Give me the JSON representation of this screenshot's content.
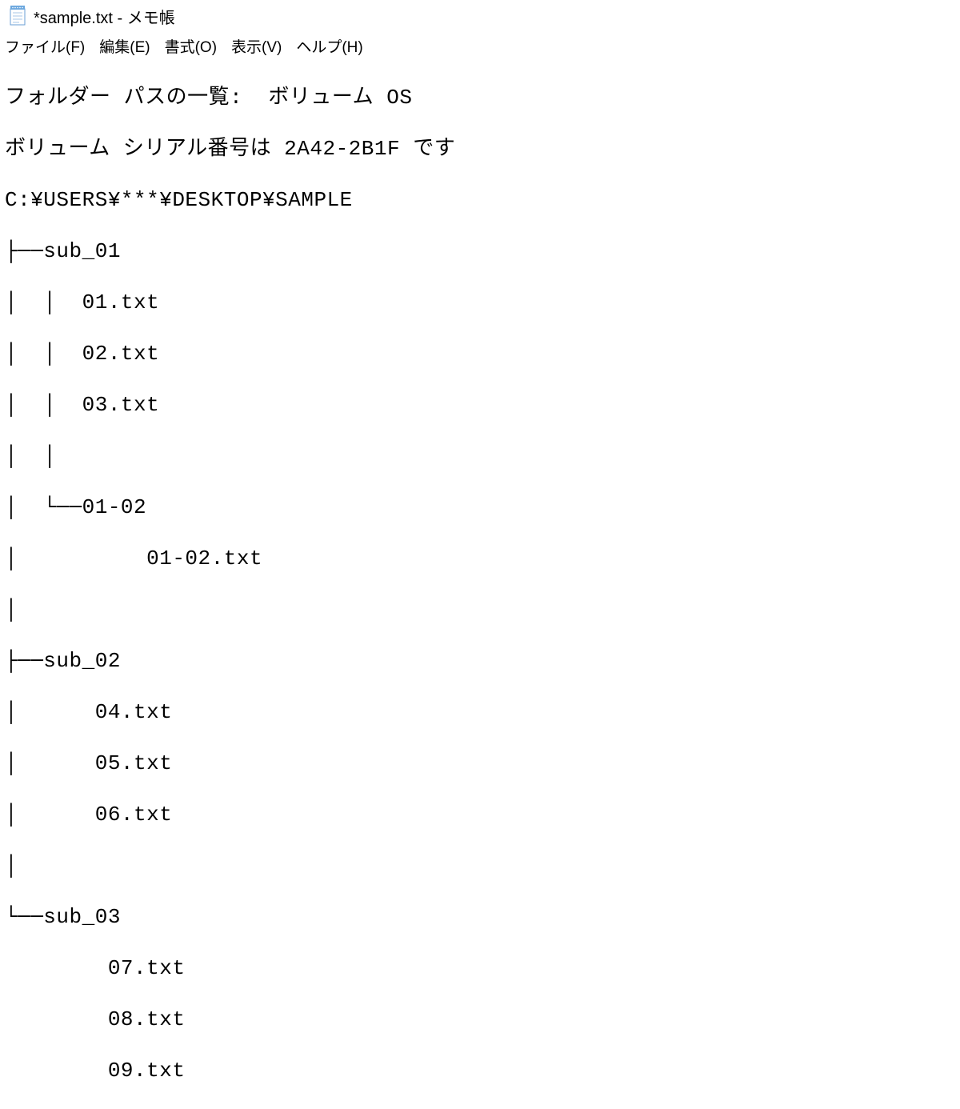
{
  "window": {
    "title": "*sample.txt - メモ帳"
  },
  "menu": {
    "file": "ファイル(F)",
    "edit": "編集(E)",
    "format": "書式(O)",
    "view": "表示(V)",
    "help": "ヘルプ(H)"
  },
  "content": {
    "line1": "フォルダー パスの一覧:  ボリューム OS",
    "line2": "ボリューム シリアル番号は 2A42-2B1F です",
    "line3": "C:¥USERS¥***¥DESKTOP¥SAMPLE",
    "line4": "├──sub_01",
    "line5": "│  │  01.txt",
    "line6": "│  │  02.txt",
    "line7": "│  │  03.txt",
    "line8": "│  │",
    "line9": "│  └──01-02",
    "line10": "│          01-02.txt",
    "line11": "│",
    "line12": "├──sub_02",
    "line13": "│      04.txt",
    "line14": "│      05.txt",
    "line15": "│      06.txt",
    "line16": "│",
    "line17": "└──sub_03",
    "line18": "        07.txt",
    "line19": "        08.txt",
    "line20": "        09.txt"
  }
}
